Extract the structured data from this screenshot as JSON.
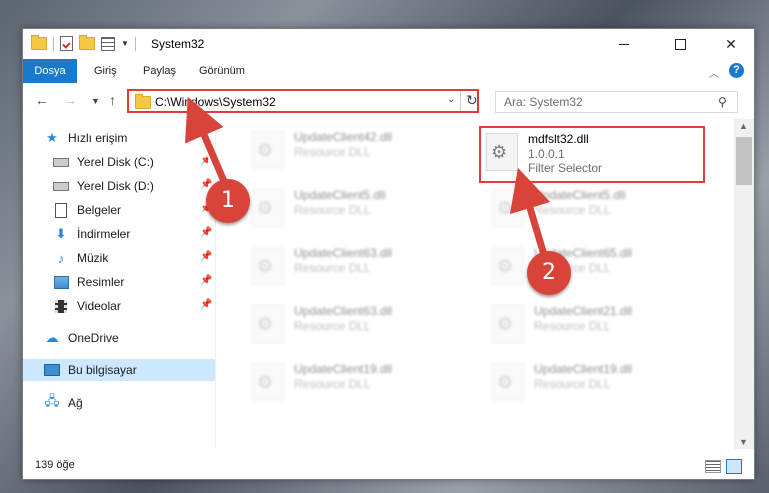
{
  "window": {
    "title": "System32",
    "controls": {
      "minimize": "—",
      "maximize": "☐",
      "close": "✕"
    }
  },
  "ribbon": {
    "tabs": [
      {
        "label": "Dosya",
        "active": true
      },
      {
        "label": "Giriş"
      },
      {
        "label": "Paylaş"
      },
      {
        "label": "Görünüm"
      }
    ],
    "help": "?"
  },
  "navbar": {
    "address": "C:\\Windows\\System32",
    "search_placeholder": "Ara: System32"
  },
  "sidebar": {
    "items": [
      {
        "label": "Hızlı erişim",
        "icon": "star-icon"
      },
      {
        "label": "Yerel Disk (C:)",
        "icon": "drive-icon",
        "pinned": true
      },
      {
        "label": "Yerel Disk (D:)",
        "icon": "drive-icon",
        "pinned": true
      },
      {
        "label": "Belgeler",
        "icon": "document-icon",
        "pinned": true
      },
      {
        "label": "İndirmeler",
        "icon": "download-icon",
        "pinned": true
      },
      {
        "label": "Müzik",
        "icon": "music-icon",
        "pinned": true
      },
      {
        "label": "Resimler",
        "icon": "picture-icon",
        "pinned": true
      },
      {
        "label": "Videolar",
        "icon": "video-icon",
        "pinned": true
      },
      {
        "label": "OneDrive",
        "icon": "cloud-icon"
      },
      {
        "label": "Bu bilgisayar",
        "icon": "computer-icon",
        "selected": true
      },
      {
        "label": "Ağ",
        "icon": "network-icon"
      }
    ]
  },
  "files": {
    "highlighted": {
      "name": "mdfslt32.dll",
      "version": "1.0.0.1",
      "description": "Filter Selector"
    },
    "left_column": [
      {
        "name": "UpdateClient42.dll",
        "type": "Resource DLL"
      },
      {
        "name": "UpdateClient5.dll",
        "type": "Resource DLL"
      },
      {
        "name": "UpdateClient63.dll",
        "type": "Resource DLL"
      },
      {
        "name": "UpdateClient63.dll",
        "type": "Resource DLL"
      },
      {
        "name": "UpdateClient19.dll",
        "type": "Resource DLL"
      }
    ],
    "right_column": [
      {
        "name": "UpdateClient5.dll",
        "type": "Resource DLL"
      },
      {
        "name": "UpdateClient65.dll",
        "type": "Resource DLL"
      },
      {
        "name": "UpdateClient21.dll",
        "type": "Resource DLL"
      },
      {
        "name": "UpdateClient19.dll",
        "type": "Resource DLL"
      }
    ]
  },
  "status": {
    "item_count": "139 öğe"
  },
  "callouts": {
    "step1": "1",
    "step2": "2",
    "color": "#d9443a"
  }
}
